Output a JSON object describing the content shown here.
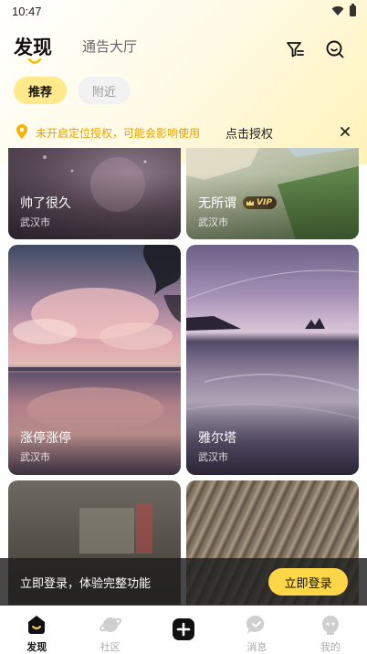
{
  "status_bar": {
    "time": "10:47"
  },
  "header": {
    "tab_active": "发现",
    "tab_other": "通告大厅"
  },
  "chips": [
    {
      "label": "推荐",
      "active": true
    },
    {
      "label": "附近",
      "active": false
    }
  ],
  "location_banner": {
    "message": "未开启定位授权，可能会影响使用",
    "action": "点击授权"
  },
  "cards": [
    {
      "name": "帅了很久",
      "city": "武汉市",
      "vip": false
    },
    {
      "name": "无所谓",
      "city": "武汉市",
      "vip": true,
      "vip_label": "VIP"
    },
    {
      "name": "涨停涨停",
      "city": "武汉市",
      "vip": false
    },
    {
      "name": "雅尔塔",
      "city": "武汉市",
      "vip": false
    },
    {
      "name": "",
      "city": "",
      "vip": false
    },
    {
      "name": "",
      "city": "",
      "vip": false
    }
  ],
  "login_prompt": {
    "message": "立即登录，体验完整功能",
    "button": "立即登录"
  },
  "bottom_nav": [
    {
      "label": "发现",
      "active": true
    },
    {
      "label": "社区",
      "active": false
    },
    {
      "label": "",
      "active": false
    },
    {
      "label": "消息",
      "active": false
    },
    {
      "label": "我的",
      "active": false
    }
  ],
  "colors": {
    "accent_yellow": "#ffd646",
    "chip_active": "#ffe98a",
    "banner_text": "#e6a100"
  }
}
